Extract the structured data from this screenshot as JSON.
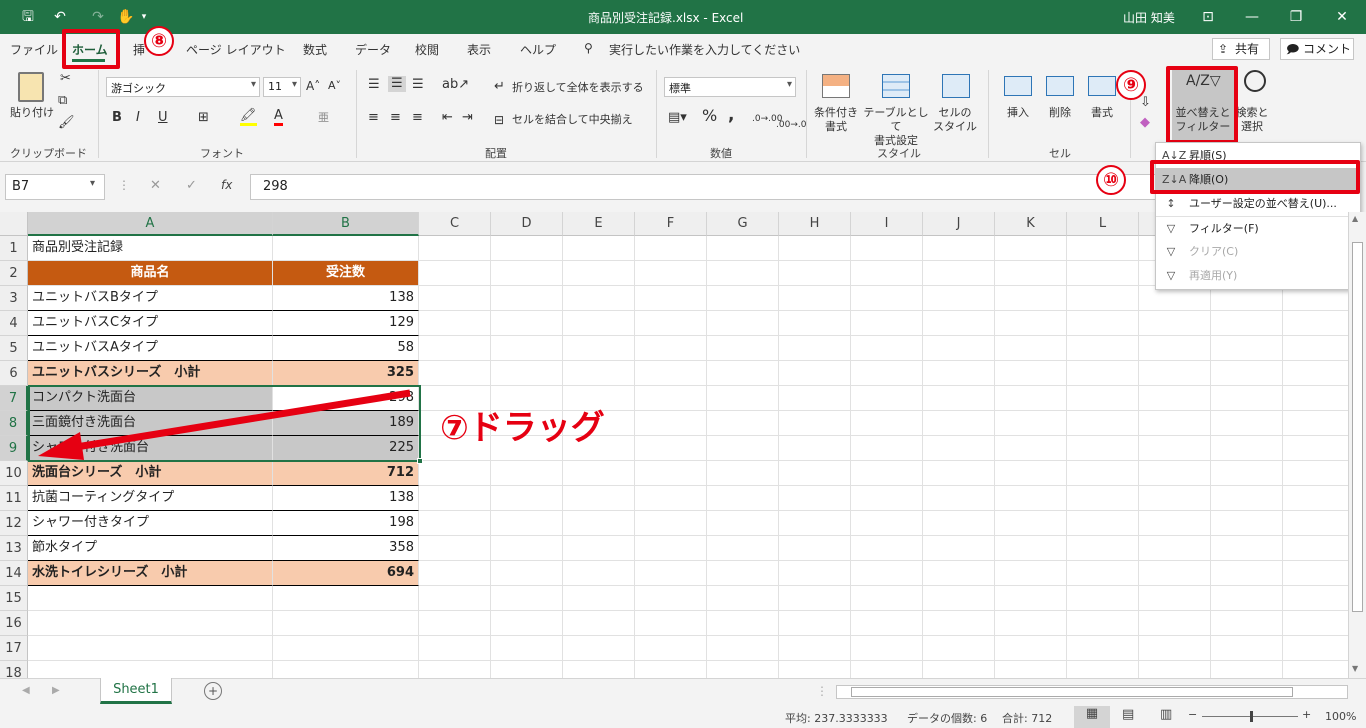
{
  "title": {
    "file": "商品別受注記録.xlsx - Excel",
    "user": "山田 知美"
  },
  "tabs": [
    "ファイル",
    "ホーム",
    "挿",
    "ページ レイアウト",
    "数式",
    "データ",
    "校閲",
    "表示",
    "ヘルプ"
  ],
  "tellme": "実行したい作業を入力してください",
  "share": "共有",
  "comment": "コメント",
  "ribbon": {
    "clipboard": {
      "paste": "貼り付け",
      "label": "クリップボード"
    },
    "font": {
      "name": "游ゴシック",
      "size": "11",
      "label": "フォント",
      "bold": "B",
      "italic": "I",
      "underline": "U"
    },
    "align": {
      "wrap": "折り返して全体を表示する",
      "merge": "セルを結合して中央揃え",
      "label": "配置"
    },
    "number": {
      "format": "標準",
      "label": "数値",
      "pct": "%",
      "comma": ","
    },
    "styles": {
      "cond": "条件付き\n書式",
      "table": "テーブルとして\n書式設定",
      "cell": "セルの\nスタイル",
      "label": "スタイル"
    },
    "cells": {
      "insert": "挿入",
      "delete": "削除",
      "format": "書式",
      "label": "セル"
    },
    "edit": {
      "sort": "並べ替えと\nフィルター",
      "find": "検索と\n選択"
    }
  },
  "namebox": "B7",
  "formula": "298",
  "fx": "fx",
  "columns": [
    "A",
    "B",
    "C",
    "D",
    "E",
    "F",
    "G",
    "H",
    "I",
    "J",
    "K",
    "L"
  ],
  "rows": [
    {
      "n": "1",
      "a": "商品別受注記録",
      "b": ""
    },
    {
      "n": "2",
      "a": "商品名",
      "b": "受注数"
    },
    {
      "n": "3",
      "a": "ユニットバスBタイプ",
      "b": "138"
    },
    {
      "n": "4",
      "a": "ユニットバスCタイプ",
      "b": "129"
    },
    {
      "n": "5",
      "a": "ユニットバスAタイプ",
      "b": "58"
    },
    {
      "n": "6",
      "a": "ユニットバスシリーズ　小計",
      "b": "325"
    },
    {
      "n": "7",
      "a": "コンパクト洗面台",
      "b": "298"
    },
    {
      "n": "8",
      "a": "三面鏡付き洗面台",
      "b": "189"
    },
    {
      "n": "9",
      "a": "シャワー付き洗面台",
      "b": "225"
    },
    {
      "n": "10",
      "a": "洗面台シリーズ　小計",
      "b": "712"
    },
    {
      "n": "11",
      "a": "抗菌コーティングタイプ",
      "b": "138"
    },
    {
      "n": "12",
      "a": "シャワー付きタイプ",
      "b": "198"
    },
    {
      "n": "13",
      "a": "節水タイプ",
      "b": "358"
    },
    {
      "n": "14",
      "a": "水洗トイレシリーズ　小計",
      "b": "694"
    },
    {
      "n": "15",
      "a": "",
      "b": ""
    },
    {
      "n": "16",
      "a": "",
      "b": ""
    },
    {
      "n": "17",
      "a": "",
      "b": ""
    },
    {
      "n": "18",
      "a": "",
      "b": ""
    }
  ],
  "menu": [
    {
      "label": "昇順(S)",
      "icon": "A↓Z",
      "disabled": false
    },
    {
      "label": "降順(O)",
      "icon": "Z↓A",
      "disabled": false
    },
    {
      "label": "ユーザー設定の並べ替え(U)...",
      "icon": "↕",
      "disabled": false
    },
    {
      "label": "フィルター(F)",
      "icon": "▽",
      "disabled": false
    },
    {
      "label": "クリア(C)",
      "icon": "▽",
      "disabled": true
    },
    {
      "label": "再適用(Y)",
      "icon": "▽",
      "disabled": true
    }
  ],
  "annotations": {
    "drag": "⑦ドラッグ",
    "b8": "⑧",
    "b9": "⑨",
    "b10": "⑩"
  },
  "sheet": "Sheet1",
  "status": {
    "avg": "平均: 237.3333333",
    "count": "データの個数: 6",
    "sum": "合計: 712",
    "zoom": "100%"
  },
  "colors": {
    "excel_green": "#217346",
    "header_orange": "#c55a11",
    "subtotal": "#f8cbad",
    "annot_red": "#e60012"
  }
}
